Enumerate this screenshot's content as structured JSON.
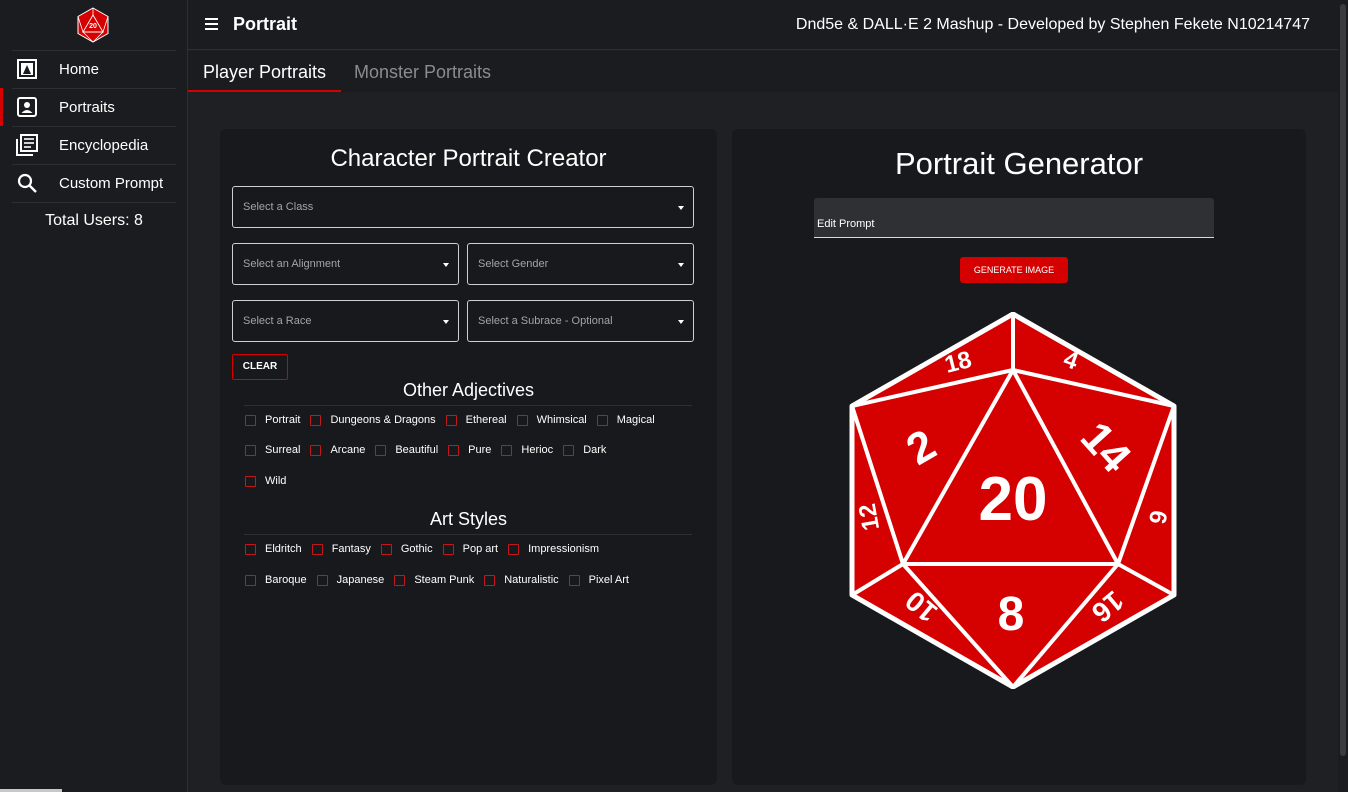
{
  "sidebar": {
    "logo_icon": "d20-logo-icon",
    "items": [
      {
        "label": "Home",
        "icon": "home-portrait-icon"
      },
      {
        "label": "Portraits",
        "icon": "account-box-icon"
      },
      {
        "label": "Encyclopedia",
        "icon": "library-books-icon"
      },
      {
        "label": "Custom Prompt",
        "icon": "search-icon"
      }
    ],
    "active_item": "Portraits",
    "total_users": "Total Users: 8"
  },
  "header": {
    "menu_icon": "menu-icon",
    "title": "Portrait",
    "credit": "Dnd5e & DALL·E 2 Mashup - Developed by Stephen Fekete N10214747"
  },
  "tabs": [
    {
      "label": "Player Portraits",
      "active": true
    },
    {
      "label": "Monster Portraits",
      "active": false
    }
  ],
  "creator": {
    "title": "Character Portrait Creator",
    "selects": {
      "class": "Select a Class",
      "alignment": "Select an Alignment",
      "gender": "Select Gender",
      "race": "Select a Race",
      "subrace": "Select a Subrace - Optional"
    },
    "clear_label": "CLEAR",
    "adjectives_title": "Other Adjectives",
    "adjectives": [
      [
        "Portrait",
        "Dungeons & Dragons",
        "Ethereal",
        "Whimsical",
        "Magical"
      ],
      [
        "Surreal",
        "Arcane",
        "Beautiful",
        "Pure",
        "Herioc",
        "Dark"
      ],
      [
        "Wild"
      ]
    ],
    "styles_title": "Art Styles",
    "styles": [
      [
        "Eldritch",
        "Fantasy",
        "Gothic",
        "Pop art",
        "Impressionism"
      ],
      [
        "Baroque",
        "Japanese",
        "Steam Punk",
        "Naturalistic",
        "Pixel Art"
      ]
    ]
  },
  "generator": {
    "title": "Portrait Generator",
    "prompt_label": "Edit Prompt",
    "generate_label": "GENERATE IMAGE",
    "image_icon": "d20-dice-icon",
    "dice_faces": {
      "center": "20",
      "left": "2",
      "right": "14",
      "bottom": "8",
      "top_left": "18",
      "top_right": "4",
      "far_left": "12",
      "far_right": "6",
      "bottom_left": "10",
      "bottom_right": "16"
    }
  },
  "colors": {
    "accent": "#d50000",
    "background": "#1f2023",
    "panel": "#18191c",
    "checkbox": "#c0181c"
  }
}
